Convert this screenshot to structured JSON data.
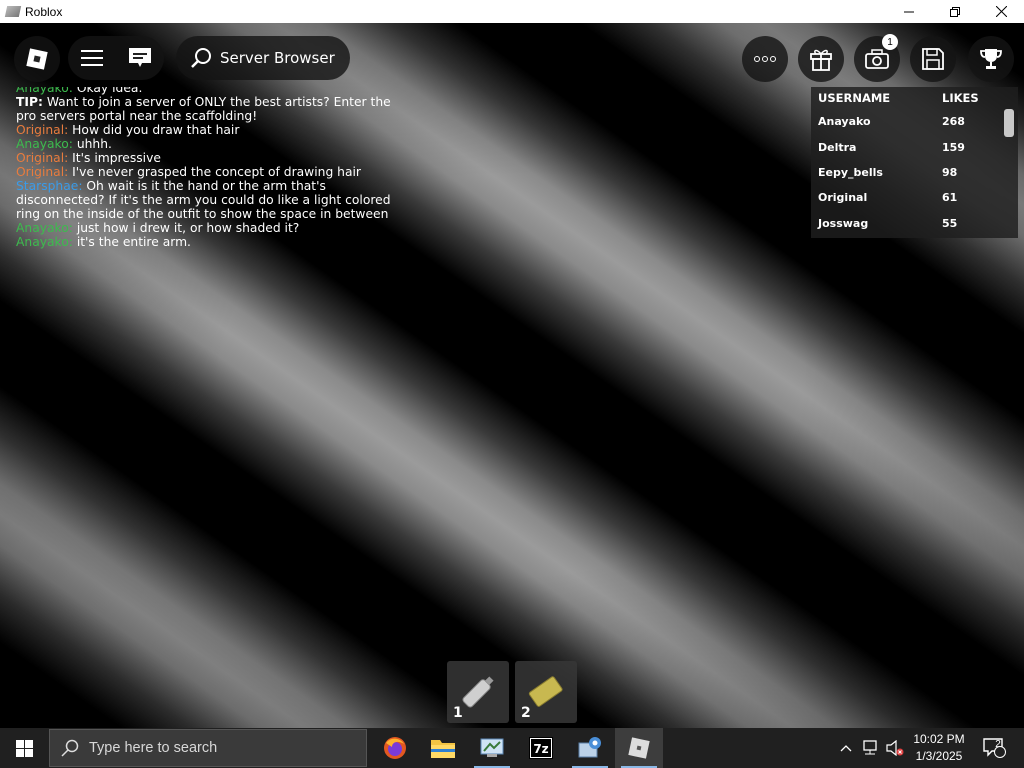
{
  "window": {
    "title": "Roblox"
  },
  "hud": {
    "server_browser_label": "Server Browser",
    "notification_count": "1"
  },
  "chat": [
    {
      "speaker": "Anayako:",
      "text": " Okay idea.",
      "color": "#3dbb4e"
    },
    {
      "speaker": "TIP:",
      "text": " Want to join a server of ONLY the best artists? Enter the pro servers portal near the scaffolding!",
      "color": "#ffffff",
      "tip": true
    },
    {
      "speaker": "Original:",
      "text": " How did you draw that hair",
      "color": "#e87c3e"
    },
    {
      "speaker": "Anayako:",
      "text": " uhhh.",
      "color": "#3dbb4e"
    },
    {
      "speaker": "Original:",
      "text": " It's impressive",
      "color": "#e87c3e"
    },
    {
      "speaker": "Original:",
      "text": " I've never grasped the concept of drawing hair",
      "color": "#e87c3e"
    },
    {
      "speaker": "Starsphae:",
      "text": " Oh wait is it the hand or the arm that's disconnected? If it's the arm you could do like a light colored ring on the inside of the outfit to show the space in between",
      "color": "#3a9be8"
    },
    {
      "speaker": "Anayako:",
      "text": " just how i drew it, or how shaded it?",
      "color": "#3dbb4e"
    },
    {
      "speaker": "Anayako:",
      "text": " it's the entire arm.",
      "color": "#3dbb4e"
    }
  ],
  "leaderboard": {
    "header_username": "USERNAME",
    "header_likes": "LIKES",
    "rows": [
      {
        "username": "Anayako",
        "likes": "268"
      },
      {
        "username": "Deltra",
        "likes": "159"
      },
      {
        "username": "Eepy_bells",
        "likes": "98"
      },
      {
        "username": "Original",
        "likes": "61"
      },
      {
        "username": "Josswag",
        "likes": "55"
      }
    ]
  },
  "hotbar": {
    "slot1": "1",
    "slot2": "2"
  },
  "taskbar": {
    "search_placeholder": "Type here to search",
    "time": "10:02 PM",
    "date": "1/3/2025",
    "notification_count": "2"
  }
}
